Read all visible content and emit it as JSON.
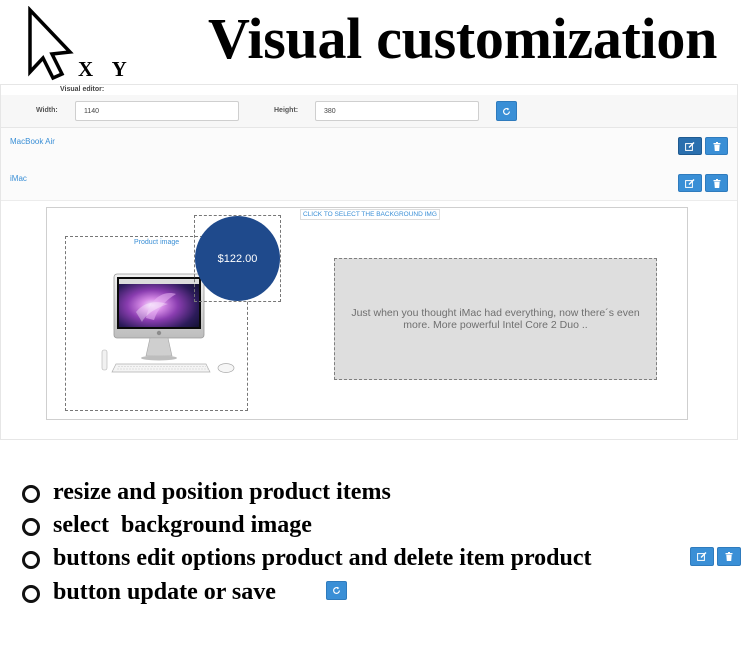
{
  "header": {
    "logo_letters": "X Y",
    "headline": "Visual customization"
  },
  "editor": {
    "label": "Visual editor:",
    "width_label": "Width:",
    "width_value": "1140",
    "height_label": "Height:",
    "height_value": "380",
    "refresh_icon": "refresh-icon"
  },
  "products": [
    {
      "name": "MacBook Air"
    },
    {
      "name": "iMac"
    }
  ],
  "canvas": {
    "bg_select_label": "CLICK TO SELECT THE BACKGROUND IMG",
    "image_label": "Product image",
    "price": "$122.00",
    "description": "Just when you thought iMac had everything, now there´s even more. More powerful Intel Core 2 Duo .."
  },
  "features": [
    "resize and position product items",
    "select  background image",
    "buttons edit options product and delete item product",
    "button update or save"
  ],
  "icons": {
    "edit": "edit-icon",
    "delete": "trash-icon",
    "refresh": "refresh-icon",
    "cursor": "cursor-arrow-icon"
  },
  "colors": {
    "accent": "#3a8fd6",
    "accent_dark": "#2a6fae",
    "price_circle": "#1f4a8c",
    "description_bg": "#dedede"
  }
}
